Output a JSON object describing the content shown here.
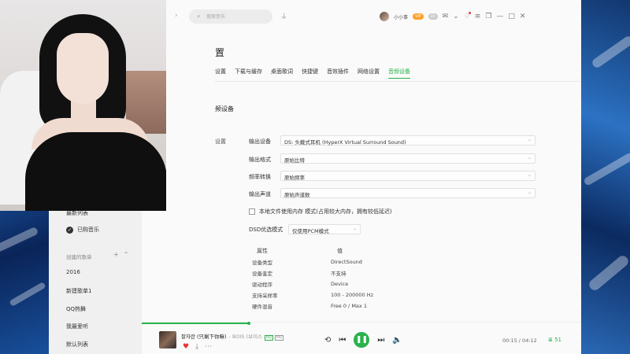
{
  "topbar": {
    "search_placeholder": "搜索音乐",
    "username": "小小事",
    "vip_label": "VIP",
    "level_label": "LV"
  },
  "settings": {
    "title": "置",
    "tabs": [
      {
        "label": "设置",
        "active": false
      },
      {
        "label": "下载与缓存",
        "active": false
      },
      {
        "label": "桌面歌词",
        "active": false
      },
      {
        "label": "快捷键",
        "active": false
      },
      {
        "label": "音效插件",
        "active": false
      },
      {
        "label": "网络设置",
        "active": false
      },
      {
        "label": "音频设备",
        "active": true
      }
    ],
    "section_title": "频设备",
    "group_label": "设置",
    "rows": [
      {
        "label": "输出设备",
        "value": "DS: 头戴式耳机 (HyperX Virtual Surround Sound)"
      },
      {
        "label": "输出格式",
        "value": "原始比特"
      },
      {
        "label": "频率转换",
        "value": "原始频率"
      },
      {
        "label": "输出声道",
        "value": "原始声道数"
      }
    ],
    "exclusive_checkbox": {
      "label": "本地文件使用内存 模式(占用较大内存，拥有较低延迟)",
      "checked": false
    },
    "dsd": {
      "label": "DSD优选模式",
      "value": "仅使用PCM模式"
    },
    "info_table": {
      "headers": [
        "属性",
        "值"
      ],
      "rows": [
        [
          "设备类型",
          "DirectSound"
        ],
        [
          "设备鉴定",
          "不支持"
        ],
        [
          "驱动程序",
          "Device"
        ],
        [
          "支持采样率",
          "100 - 200000 Hz"
        ],
        [
          "硬件混音",
          "Free 0 / Max 1"
        ]
      ]
    }
  },
  "sidebar": {
    "items_top": [
      {
        "label": "最新列表"
      },
      {
        "label": "已购音乐"
      }
    ],
    "created_section": "创建的歌单",
    "playlists": [
      {
        "label": "2016"
      },
      {
        "label": "新建歌单1"
      },
      {
        "label": "QQ热舞"
      },
      {
        "label": "我最爱听"
      },
      {
        "label": "默认列表"
      }
    ]
  },
  "player": {
    "track_title": "잘자란 (只剩下你嘛)",
    "artist": "- BOIS (보이스",
    "quality_badge": "HQ",
    "mv_badge": "MV",
    "time": "00:15 / 04:12",
    "playlist_count": "51",
    "progress": 0.06
  },
  "colors": {
    "accent": "#2bb24c",
    "heart": "#e33333"
  }
}
